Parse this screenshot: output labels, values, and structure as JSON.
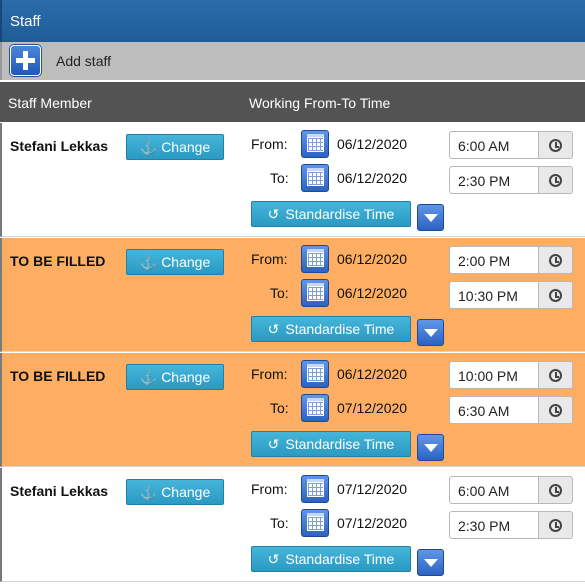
{
  "header": {
    "title": "Staff"
  },
  "toolbar": {
    "add_label": "Add staff",
    "add_icon": "plus-icon"
  },
  "columns": {
    "staff": "Staff Member",
    "time": "Working From-To Time"
  },
  "labels": {
    "change": "Change",
    "from": "From:",
    "to": "To:",
    "standardise": "Standardise Time"
  },
  "icons": {
    "anchor": "⚓",
    "rotate": "↺",
    "calendar": "calendar-icon",
    "clock": "clock-icon",
    "down": "chevron-down-icon"
  },
  "colors": {
    "header": "#1f5c98",
    "unfilled_row": "#fdae62",
    "button": "#2b9ac3"
  },
  "rows": [
    {
      "name": "Stefani Lekkas",
      "from_date": "06/12/2020",
      "from_time": "6:00 AM",
      "to_date": "06/12/2020",
      "to_time": "2:30 PM",
      "highlight": false
    },
    {
      "name": "TO BE FILLED",
      "from_date": "06/12/2020",
      "from_time": "2:00 PM",
      "to_date": "06/12/2020",
      "to_time": "10:30 PM",
      "highlight": true
    },
    {
      "name": "TO BE FILLED",
      "from_date": "06/12/2020",
      "from_time": "10:00 PM",
      "to_date": "07/12/2020",
      "to_time": "6:30 AM",
      "highlight": true
    },
    {
      "name": "Stefani Lekkas",
      "from_date": "07/12/2020",
      "from_time": "6:00 AM",
      "to_date": "07/12/2020",
      "to_time": "2:30 PM",
      "highlight": false
    }
  ]
}
